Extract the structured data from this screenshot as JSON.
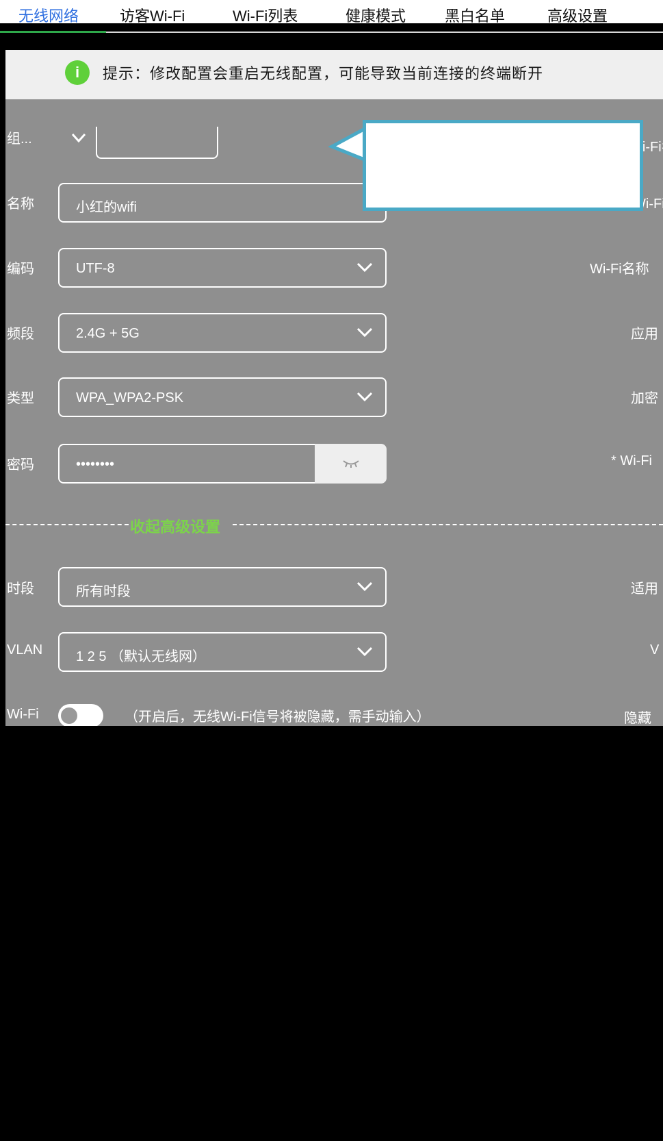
{
  "tabs": [
    {
      "label": "无线网络",
      "active": true
    },
    {
      "label": "访客Wi-Fi",
      "active": false
    },
    {
      "label": "Wi-Fi列表",
      "active": false
    },
    {
      "label": "健康模式",
      "active": false
    },
    {
      "label": "黑白名单",
      "active": false
    },
    {
      "label": "高级设置",
      "active": false
    }
  ],
  "notice": {
    "icon": "info-icon",
    "text": "提示：修改配置会重启无线配置，可能导致当前连接的终端断开"
  },
  "form": {
    "group_select": "组...",
    "rows": [
      {
        "label": "名称",
        "value": "小红的wifi",
        "type": "input"
      },
      {
        "label": "编码",
        "value": "UTF-8",
        "type": "select"
      },
      {
        "label": "频段",
        "value": "2.4G + 5G",
        "type": "select"
      },
      {
        "label": "类型",
        "value": "WPA_WPA2-PSK",
        "type": "select"
      },
      {
        "label": "密码",
        "value": "••••••••",
        "type": "password"
      }
    ],
    "collapse_link": "收起高级设置",
    "advanced_rows": [
      {
        "label": "时段",
        "value": "所有时段",
        "type": "select"
      },
      {
        "label": "VLAN",
        "value": "1 2 5 （默认无线网）",
        "type": "select"
      }
    ],
    "hide_wifi_label": "Wi-Fi",
    "hide_wifi_desc": "（开启后，无线Wi-Fi信号将被隐藏，需手动输入）",
    "hide_wifi_on": false
  },
  "right_labels": [
    "Wi-Fi名",
    "Wi-Fi名称",
    "应用",
    "加密",
    "* Wi-Fi",
    "适用",
    "V",
    "隐藏"
  ],
  "colors": {
    "active_tab": "#2f6fe0",
    "accent_green": "#5fd03a",
    "tooltip_border": "#4aa9c6",
    "panel_bg": "#8f8f8f"
  }
}
